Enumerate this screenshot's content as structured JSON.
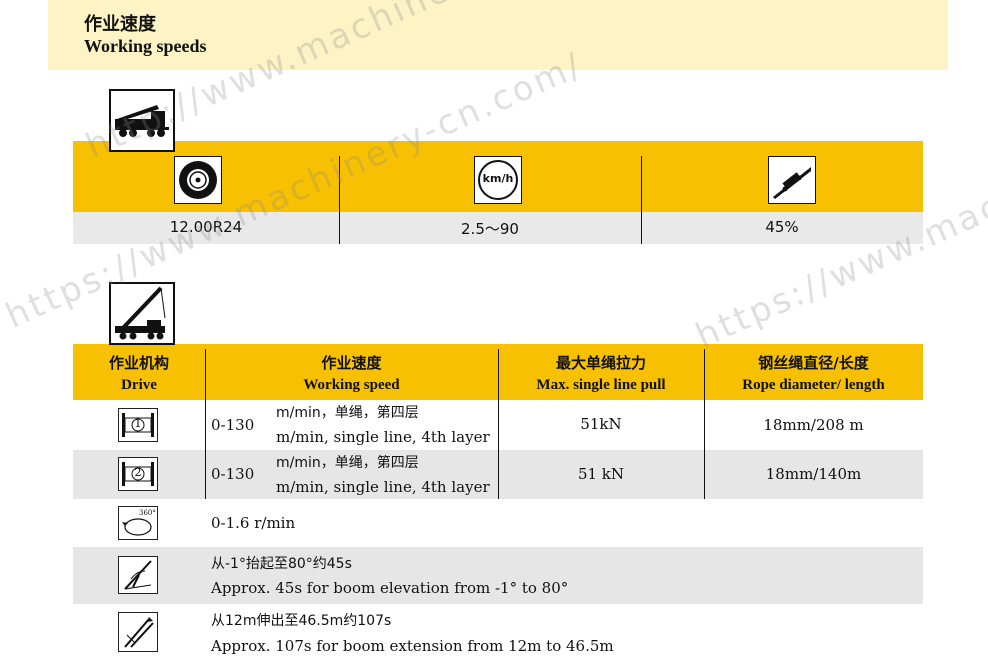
{
  "header": {
    "title_cn": "作业速度",
    "title_en": "Working speeds"
  },
  "travel": {
    "values": [
      "12.00R24",
      "2.5～90",
      "45%"
    ],
    "icon_labels": [
      "tire-icon",
      "kmh-icon",
      "gradeability-icon"
    ],
    "kmh_text": "km/h"
  },
  "table": {
    "headers": [
      {
        "cn": "作业机构",
        "en": "Drive"
      },
      {
        "cn": "作业速度",
        "en": "Working speed"
      },
      {
        "cn": "最大单绳拉力",
        "en": "Max. single line pull"
      },
      {
        "cn": "钢丝绳直径/长度",
        "en": "Rope diameter/ length"
      }
    ],
    "rows": [
      {
        "icon": "winch-1-icon",
        "badge": "1",
        "range": "0-130",
        "unit_cn": "m/min，单绳，第四层",
        "unit_en": "m/min, single line, 4th layer",
        "pull": "51kN",
        "rope": "18mm/208 m"
      },
      {
        "icon": "winch-2-icon",
        "badge": "2",
        "range": "0-130",
        "unit_cn": "m/min，单绳，第四层",
        "unit_en": "m/min, single line, 4th layer",
        "pull": "51 kN",
        "rope": "18mm/140m"
      },
      {
        "icon": "slewing-icon",
        "badge": "360°",
        "line1": "0-1.6 r/min"
      },
      {
        "icon": "boom-elevation-icon",
        "line1": "从-1°抬起至80°约45s",
        "line2": "Approx. 45s for boom elevation from -1° to 80°"
      },
      {
        "icon": "boom-extension-icon",
        "line1": "从12m伸出至46.5m约107s",
        "line2": "Approx. 107s for boom extension from 12m to 46.5m"
      }
    ]
  },
  "watermarks": [
    "http://www.machinery-cn.com/",
    "https://www.machinery-cn.com/",
    "https://www.machinery-"
  ]
}
